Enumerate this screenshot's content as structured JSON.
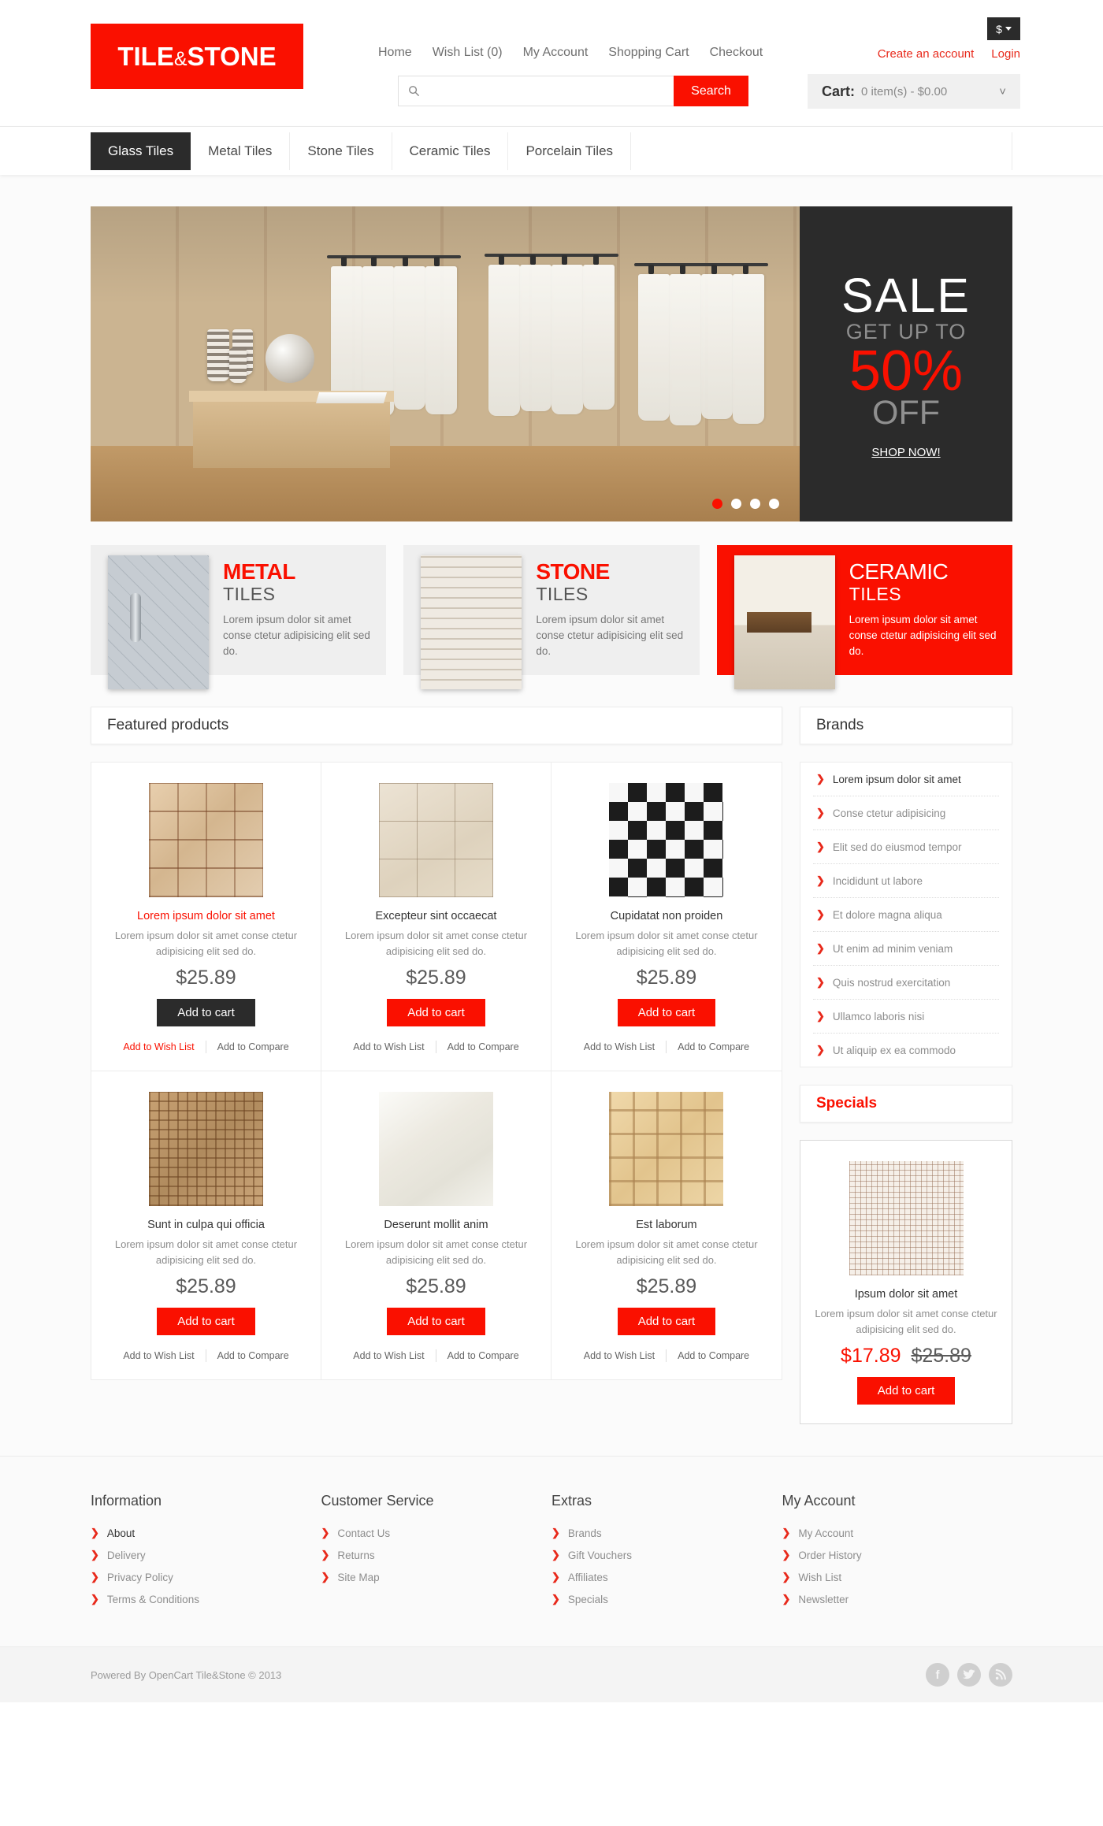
{
  "header": {
    "logo": {
      "part1": "TILE",
      "amp": "&",
      "part2": "STONE"
    },
    "top_links": [
      "Home",
      "Wish List (0)",
      "My Account",
      "Shopping Cart",
      "Checkout"
    ],
    "currency": "$",
    "account_links": [
      "Create an account",
      "Login"
    ],
    "search": {
      "placeholder": "",
      "value": "",
      "button": "Search",
      "icon": "search-icon"
    },
    "cart": {
      "label": "Cart:",
      "summary": "0 item(s) - $0.00"
    }
  },
  "nav": {
    "items": [
      "Glass Tiles",
      "Metal Tiles",
      "Stone Tiles",
      "Ceramic Tiles",
      "Porcelain Tiles"
    ],
    "active_index": 0
  },
  "slider": {
    "dots": 4,
    "active_dot": 0
  },
  "sale_banner": {
    "line1": "SALE",
    "line2": "GET UP TO",
    "line3": "50%",
    "line4": "OFF",
    "cta": "SHOP NOW!"
  },
  "promos": [
    {
      "title_big": "METAL",
      "title_sub": "TILES",
      "desc": "Lorem ipsum dolor sit amet conse ctetur adipisicing elit sed do.",
      "style": "gray"
    },
    {
      "title_big": "STONE",
      "title_sub": "TILES",
      "desc": "Lorem ipsum dolor sit amet conse ctetur adipisicing elit sed do.",
      "style": "gray"
    },
    {
      "title_big": "CERAMIC",
      "title_sub": "TILES",
      "desc": "Lorem ipsum dolor sit amet conse ctetur adipisicing elit sed do.",
      "style": "red"
    }
  ],
  "featured": {
    "heading": "Featured products",
    "products": [
      {
        "name": "Lorem ipsum dolor sit amet",
        "desc": "Lorem ipsum dolor sit amet conse ctetur adipisicing elit sed do.",
        "price": "$25.89",
        "cart": "Add to cart",
        "wish": "Add to Wish List",
        "compare": "Add to Compare",
        "hover": true
      },
      {
        "name": "Excepteur sint occaecat",
        "desc": "Lorem ipsum dolor sit amet conse ctetur adipisicing elit sed do.",
        "price": "$25.89",
        "cart": "Add to cart",
        "wish": "Add to Wish List",
        "compare": "Add to Compare",
        "hover": false
      },
      {
        "name": "Cupidatat non proiden",
        "desc": "Lorem ipsum dolor sit amet conse ctetur adipisicing elit sed do.",
        "price": "$25.89",
        "cart": "Add to cart",
        "wish": "Add to Wish List",
        "compare": "Add to Compare",
        "hover": false
      },
      {
        "name": "Sunt in culpa qui officia",
        "desc": "Lorem ipsum dolor sit amet conse ctetur adipisicing elit sed do.",
        "price": "$25.89",
        "cart": "Add to cart",
        "wish": "Add to Wish List",
        "compare": "Add to Compare",
        "hover": false
      },
      {
        "name": "Deserunt mollit anim",
        "desc": "Lorem ipsum dolor sit amet conse ctetur adipisicing elit sed do.",
        "price": "$25.89",
        "cart": "Add to cart",
        "wish": "Add to Wish List",
        "compare": "Add to Compare",
        "hover": false
      },
      {
        "name": "Est laborum",
        "desc": "Lorem ipsum dolor sit amet conse ctetur adipisicing elit sed do.",
        "price": "$25.89",
        "cart": "Add to cart",
        "wish": "Add to Wish List",
        "compare": "Add to Compare",
        "hover": false
      }
    ]
  },
  "brands": {
    "heading": "Brands",
    "items": [
      "Lorem ipsum dolor sit amet",
      "Conse ctetur adipisicing",
      "Elit sed do eiusmod tempor",
      "Incididunt ut labore",
      "Et dolore magna aliqua",
      "Ut enim ad minim veniam",
      "Quis nostrud exercitation",
      "Ullamco laboris nisi",
      "Ut aliquip ex ea commodo"
    ]
  },
  "specials": {
    "heading": "Specials",
    "product": {
      "name": "Ipsum dolor sit amet",
      "desc": "Lorem ipsum dolor sit amet conse ctetur adipisicing elit sed do.",
      "price_new": "$17.89",
      "price_old": "$25.89",
      "cart": "Add to cart"
    }
  },
  "footer": {
    "columns": [
      {
        "heading": "Information",
        "links": [
          "About",
          "Delivery",
          "Privacy Policy",
          "Terms & Conditions"
        ]
      },
      {
        "heading": "Customer Service",
        "links": [
          "Contact Us",
          "Returns",
          "Site Map"
        ]
      },
      {
        "heading": "Extras",
        "links": [
          "Brands",
          "Gift Vouchers",
          "Affiliates",
          "Specials"
        ]
      },
      {
        "heading": "My Account",
        "links": [
          "My Account",
          "Order History",
          "Wish List",
          "Newsletter"
        ]
      }
    ],
    "copyright": "Powered By OpenCart Tile&Stone © 2013",
    "socials": [
      "facebook-icon",
      "twitter-icon",
      "rss-icon"
    ]
  },
  "colors": {
    "brand_red": "#fa1000",
    "link_red": "#e8291b",
    "dark": "#2b2b2b"
  }
}
